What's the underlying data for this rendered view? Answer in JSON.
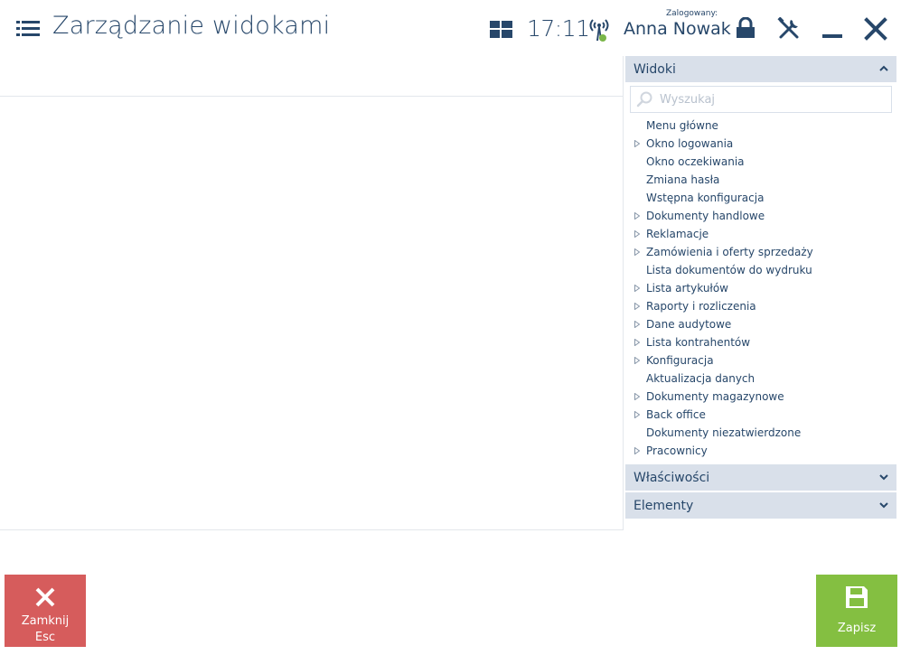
{
  "header": {
    "title": "Zarządzanie widokami",
    "clock": "17:11",
    "user_caption": "Zalogowany:",
    "user_name": "Anna Nowak"
  },
  "panel": {
    "views_title": "Widoki",
    "search_placeholder": "Wyszukaj",
    "items": [
      {
        "label": "Menu główne",
        "expandable": false
      },
      {
        "label": "Okno logowania",
        "expandable": true
      },
      {
        "label": "Okno oczekiwania",
        "expandable": false
      },
      {
        "label": "Zmiana hasła",
        "expandable": false
      },
      {
        "label": "Wstępna konfiguracja",
        "expandable": false
      },
      {
        "label": "Dokumenty handlowe",
        "expandable": true
      },
      {
        "label": "Reklamacje",
        "expandable": true
      },
      {
        "label": "Zamówienia i oferty sprzedaży",
        "expandable": true
      },
      {
        "label": "Lista dokumentów do wydruku",
        "expandable": false
      },
      {
        "label": "Lista artykułów",
        "expandable": true
      },
      {
        "label": "Raporty i rozliczenia",
        "expandable": true
      },
      {
        "label": "Dane audytowe",
        "expandable": true
      },
      {
        "label": "Lista kontrahentów",
        "expandable": true
      },
      {
        "label": "Konfiguracja",
        "expandable": true
      },
      {
        "label": "Aktualizacja danych",
        "expandable": false
      },
      {
        "label": "Dokumenty magazynowe",
        "expandable": true
      },
      {
        "label": "Back office",
        "expandable": true
      },
      {
        "label": "Dokumenty niezatwierdzone",
        "expandable": false
      },
      {
        "label": "Pracownicy",
        "expandable": true
      }
    ],
    "properties_title": "Właściwości",
    "elements_title": "Elementy"
  },
  "footer": {
    "close_label": "Zamknij",
    "close_shortcut": "Esc",
    "save_label": "Zapisz"
  },
  "colors": {
    "primary_text": "#27476a",
    "section_bg": "#d9e0ea",
    "close_button": "#d65c5c",
    "save_button": "#84bf41",
    "status_dot": "#7ab648"
  },
  "icons": [
    "menu-icon",
    "tiles-icon",
    "connection-icon",
    "lock-icon",
    "tools-icon",
    "minimize-icon",
    "close-icon",
    "search-icon",
    "chevron-up-icon",
    "chevron-down-icon",
    "expand-arrow-icon",
    "save-icon"
  ]
}
